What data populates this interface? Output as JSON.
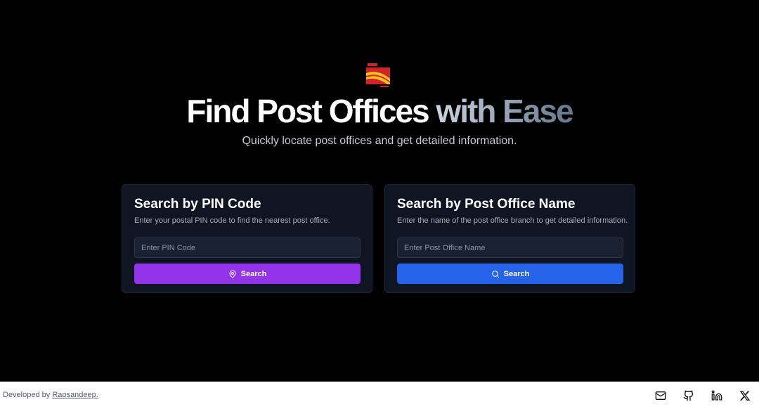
{
  "hero": {
    "title_part1": "Find Post Offices",
    "title_part2": "with Ease",
    "subtitle": "Quickly locate post offices and get detailed information."
  },
  "pin_card": {
    "title": "Search by PIN Code",
    "description": "Enter your postal PIN code to find the nearest post office.",
    "placeholder": "Enter PIN Code",
    "button_label": "Search",
    "button_icon": "map-pin-icon",
    "button_color": "#9333ea"
  },
  "name_card": {
    "title": "Search by Post Office Name",
    "description": "Enter the name of the post office branch to get detailed information.",
    "placeholder": "Enter Post Office Name",
    "button_label": "Search",
    "button_icon": "search-icon",
    "button_color": "#2563eb"
  },
  "footer": {
    "developed_by": "Developed by",
    "author": "Raosandeep.",
    "icons": [
      "mail-icon",
      "github-icon",
      "linkedin-icon",
      "x-icon"
    ]
  },
  "colors": {
    "background": "#000000",
    "card": "#0f1523",
    "logo_red": "#d2232a",
    "logo_yellow": "#f6c31c"
  }
}
